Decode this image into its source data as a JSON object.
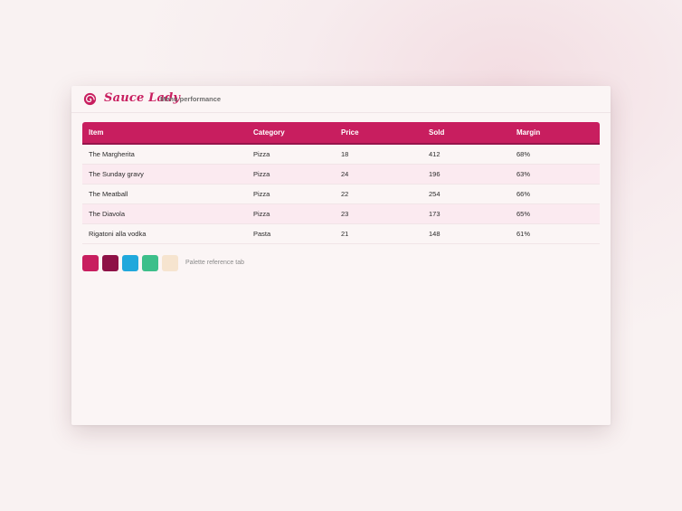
{
  "header": {
    "brand": "Sauce Lady",
    "subtitle": "Menu performance",
    "logo_icon": "swirl-logo-icon"
  },
  "table": {
    "columns": [
      "Item",
      "Category",
      "Price",
      "Sold",
      "Margin"
    ],
    "rows": [
      [
        "The Margherita",
        "Pizza",
        "18",
        "412",
        "68%"
      ],
      [
        "The Sunday gravy",
        "Pizza",
        "24",
        "196",
        "63%"
      ],
      [
        "The Meatball",
        "Pizza",
        "22",
        "254",
        "66%"
      ],
      [
        "The Diavola",
        "Pizza",
        "23",
        "173",
        "65%"
      ],
      [
        "Rigatoni alla vodka",
        "Pasta",
        "21",
        "148",
        "61%"
      ]
    ]
  },
  "palette": {
    "label": "Palette reference tab",
    "colors": [
      "#c81e5f",
      "#8e1146",
      "#20a8dc",
      "#3dbf8a",
      "#f6e4cf"
    ]
  },
  "colors": {
    "accent": "#c81e5f"
  }
}
